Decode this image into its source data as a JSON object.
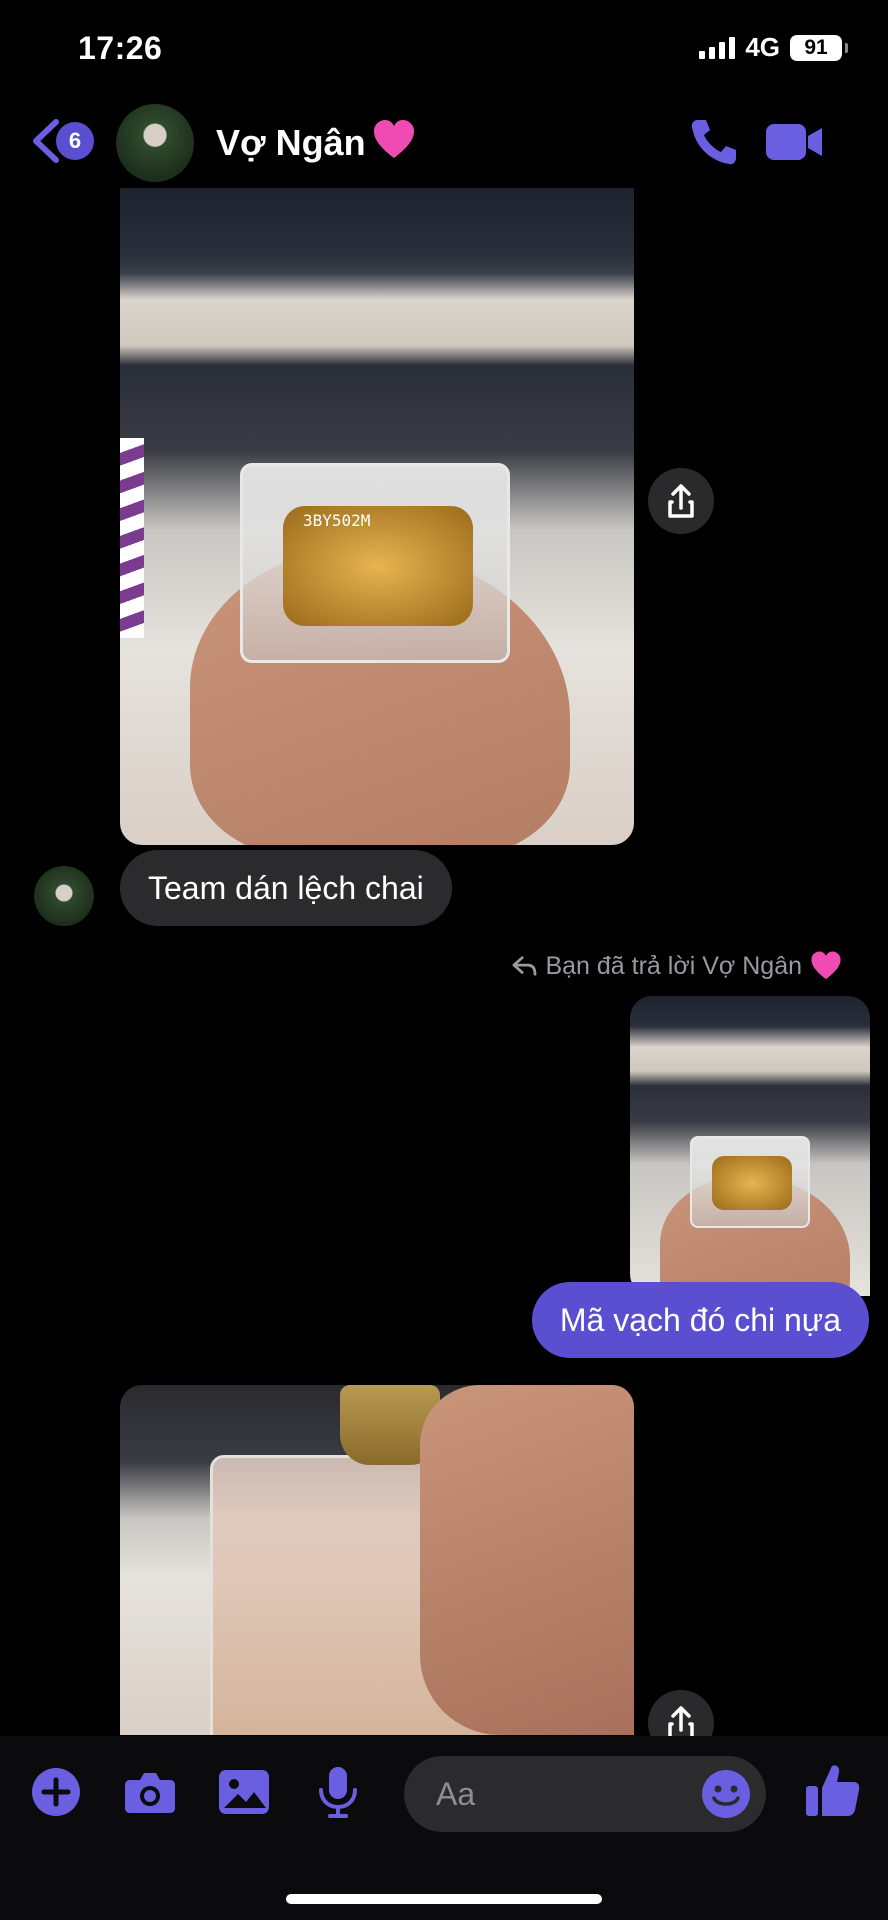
{
  "status_bar": {
    "time": "17:26",
    "network": "4G",
    "battery": "91"
  },
  "header": {
    "back_badge": "6",
    "contact_name": "Vợ Ngân"
  },
  "messages": {
    "photo1_code": "3BY502M",
    "incoming_text": "Team dán lệch chai",
    "reply_label": "Bạn đã trả lời Vợ Ngân",
    "outgoing_text": "Mã vạch đó chi nựa"
  },
  "composer": {
    "placeholder": "Aa"
  },
  "colors": {
    "accent": "#5b4fd1",
    "incoming_bubble": "#2b2b2d",
    "background": "#000000"
  },
  "icons": [
    "back-chevron-icon",
    "heart-icon",
    "phone-icon",
    "video-camera-icon",
    "share-icon",
    "reply-arrow-icon",
    "plus-icon",
    "camera-icon",
    "image-icon",
    "microphone-icon",
    "emoji-icon",
    "thumbs-up-icon"
  ]
}
